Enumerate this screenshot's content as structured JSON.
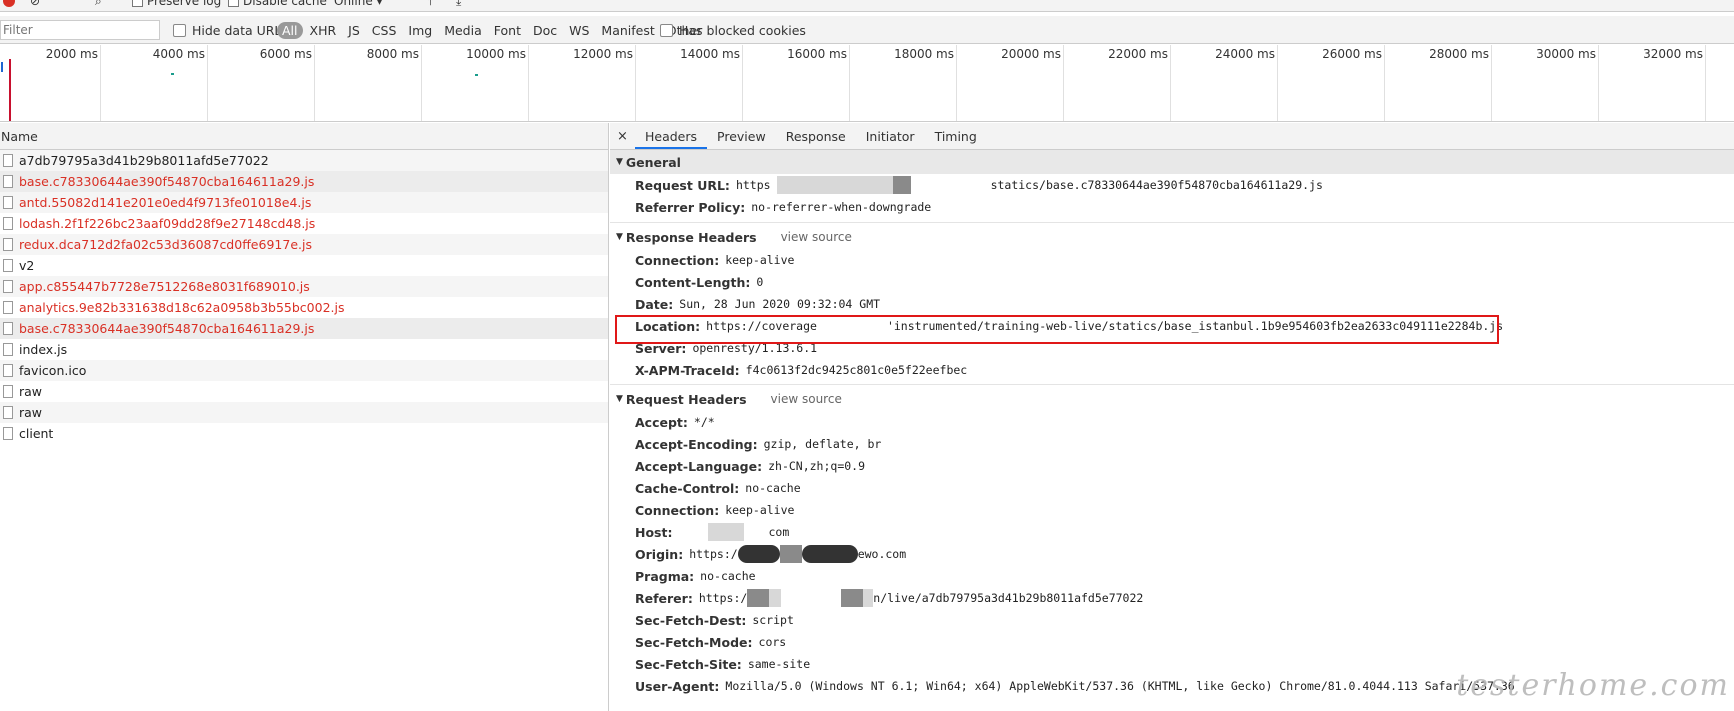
{
  "toolbar": {
    "preserve_log": "Preserve log",
    "disable_cache": "Disable cache",
    "throttle": "Online"
  },
  "filter_bar": {
    "filter_placeholder": "Filter",
    "hide_data_urls": "Hide data URLs",
    "types": [
      "All",
      "XHR",
      "JS",
      "CSS",
      "Img",
      "Media",
      "Font",
      "Doc",
      "WS",
      "Manifest",
      "Other"
    ],
    "active_type": "All",
    "has_blocked_cookies": "Has blocked cookies"
  },
  "timeline": {
    "ticks": [
      "2000 ms",
      "4000 ms",
      "6000 ms",
      "8000 ms",
      "10000 ms",
      "12000 ms",
      "14000 ms",
      "16000 ms",
      "18000 ms",
      "20000 ms",
      "22000 ms",
      "24000 ms",
      "26000 ms",
      "28000 ms",
      "30000 ms",
      "32000 ms"
    ]
  },
  "requests": {
    "column": "Name",
    "rows": [
      {
        "name": "a7db79795a3d41b29b8011afd5e77022",
        "error": false
      },
      {
        "name": "base.c78330644ae390f54870cba164611a29.js",
        "error": true
      },
      {
        "name": "antd.55082d141e201e0ed4f9713fe01018e4.js",
        "error": true
      },
      {
        "name": "lodash.2f1f226bc23aaf09dd28f9e27148cd48.js",
        "error": true
      },
      {
        "name": "redux.dca712d2fa02c53d36087cd0ffe6917e.js",
        "error": true
      },
      {
        "name": "v2",
        "error": false
      },
      {
        "name": "app.c855447b7728e7512268e8031f689010.js",
        "error": true
      },
      {
        "name": "analytics.9e82b331638d18c62a0958b3b55bc002.js",
        "error": true
      },
      {
        "name": "base.c78330644ae390f54870cba164611a29.js",
        "error": true
      },
      {
        "name": "index.js",
        "error": false
      },
      {
        "name": "favicon.ico",
        "error": false
      },
      {
        "name": "raw",
        "error": false
      },
      {
        "name": "raw",
        "error": false
      },
      {
        "name": "client",
        "error": false
      }
    ]
  },
  "details": {
    "close": "×",
    "tabs": [
      "Headers",
      "Preview",
      "Response",
      "Initiator",
      "Timing"
    ],
    "active_tab": "Headers",
    "general": {
      "title": "General",
      "request_url_label": "Request URL:",
      "request_url_a": "https",
      "request_url_b": "statics/base.c78330644ae390f54870cba164611a29.js",
      "referrer_policy_label": "Referrer Policy:",
      "referrer_policy": "no-referrer-when-downgrade"
    },
    "response_headers": {
      "title": "Response Headers",
      "view_source": "view source",
      "items": [
        {
          "k": "Connection:",
          "v": "keep-alive"
        },
        {
          "k": "Content-Length:",
          "v": "0"
        },
        {
          "k": "Date:",
          "v": "Sun, 28 Jun 2020 09:32:04 GMT"
        }
      ],
      "location_label": "Location:",
      "location_a": "https://coverage",
      "location_b": "'instrumented/training-web-live/statics/base_istanbul.1b9e954603fb2ea2633c049111e2284b.js",
      "items_after": [
        {
          "k": "Server:",
          "v": "openresty/1.13.6.1"
        },
        {
          "k": "X-APM-TraceId:",
          "v": "f4c0613f2dc9425c801c0e5f22eefbec"
        }
      ]
    },
    "request_headers": {
      "title": "Request Headers",
      "view_source": "view source",
      "accept_label": "Accept:",
      "accept": "*/*",
      "accept_encoding_label": "Accept-Encoding:",
      "accept_encoding": "gzip, deflate, br",
      "accept_language_label": "Accept-Language:",
      "accept_language": "zh-CN,zh;q=0.9",
      "cache_control_label": "Cache-Control:",
      "cache_control": "no-cache",
      "connection_label": "Connection:",
      "connection": "keep-alive",
      "host_label": "Host:",
      "host_suffix": "com",
      "origin_label": "Origin:",
      "origin_prefix": "https:/",
      "origin_suffix": "ewo.com",
      "pragma_label": "Pragma:",
      "pragma": "no-cache",
      "referer_label": "Referer:",
      "referer_prefix": "https:/",
      "referer_suffix": "n/live/a7db79795a3d41b29b8011afd5e77022",
      "sec_fetch_dest_label": "Sec-Fetch-Dest:",
      "sec_fetch_dest": "script",
      "sec_fetch_mode_label": "Sec-Fetch-Mode:",
      "sec_fetch_mode": "cors",
      "sec_fetch_site_label": "Sec-Fetch-Site:",
      "sec_fetch_site": "same-site",
      "user_agent_label": "User-Agent:",
      "user_agent": "Mozilla/5.0 (Windows NT 6.1; Win64; x64) AppleWebKit/537.36 (KHTML, like Gecko) Chrome/81.0.4044.113 Safari/537.36"
    }
  },
  "watermark": "testerhome.com",
  "colors": {
    "error": "#d93025",
    "highlight_box": "#e01818",
    "tab_accent": "#1a73e8"
  }
}
